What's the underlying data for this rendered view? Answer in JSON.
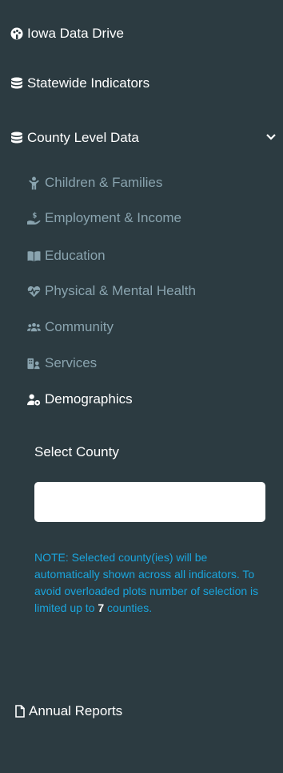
{
  "nav": {
    "home": {
      "label": "Iowa Data Drive",
      "icon": "palette-icon"
    },
    "statewide": {
      "label": "Statewide Indicators",
      "icon": "database-icon"
    },
    "county": {
      "label": "County Level Data",
      "icon": "database-icon",
      "expanded": true
    }
  },
  "county_items": [
    {
      "label": "Children & Families",
      "icon": "child-icon"
    },
    {
      "label": "Employment & Income",
      "icon": "hand-money-icon"
    },
    {
      "label": "Education",
      "icon": "book-icon"
    },
    {
      "label": "Physical & Mental Health",
      "icon": "heartbeat-icon"
    },
    {
      "label": "Community",
      "icon": "users-icon"
    },
    {
      "label": "Services",
      "icon": "services-icon"
    },
    {
      "label": "Demographics",
      "icon": "user-cog-icon",
      "active": true
    }
  ],
  "select_county": {
    "label": "Select County",
    "value": ""
  },
  "note": {
    "text_before": "NOTE: Selected county(ies) will be automatically shown across all indicators. To avoid overloaded plots number of selection is limited up to ",
    "limit": "7",
    "text_after": " counties."
  },
  "annual_reports": {
    "label": "Annual Reports",
    "icon": "file-icon"
  },
  "colors": {
    "background": "#2c3b41",
    "sub_item": "#8aa4af",
    "note": "#1aa5dd"
  }
}
